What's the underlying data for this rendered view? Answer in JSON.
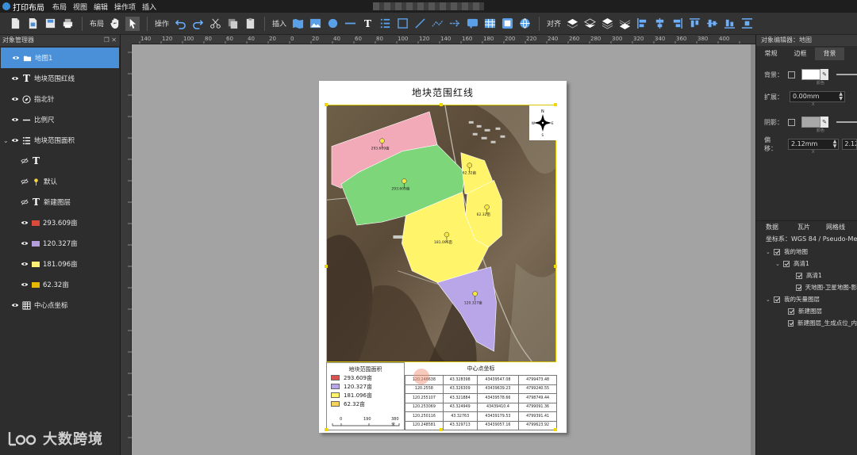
{
  "app": {
    "title": "打印布局",
    "menu": [
      "布局",
      "视图",
      "编辑",
      "操作项",
      "插入"
    ]
  },
  "toolbar": {
    "layout_label": "布局",
    "operate_label": "操作",
    "insert_label": "插入",
    "align_label": "对齐"
  },
  "left_panel": {
    "header": "对象管理器",
    "layers": [
      {
        "label": "地图1",
        "icon": "folder-icon",
        "selected": true
      },
      {
        "label": "地块范围红线",
        "icon": "text-icon"
      },
      {
        "label": "指北针",
        "icon": "compass-icon"
      },
      {
        "label": "比例尺",
        "icon": "scale-icon"
      },
      {
        "label": "地块范围面积",
        "icon": "legend-icon",
        "expanded": true
      },
      {
        "label": "",
        "icon": "text-icon"
      },
      {
        "label": "默认",
        "icon": "pin-icon"
      },
      {
        "label": "新建图层",
        "icon": "text-icon"
      },
      {
        "label": "293.609亩",
        "color": "#d94a3a"
      },
      {
        "label": "120.327亩",
        "color": "#b39ddb"
      },
      {
        "label": "181.096亩",
        "color": "#fff176"
      },
      {
        "label": "62.32亩",
        "color": "#e6b800"
      },
      {
        "label": "中心点坐标",
        "icon": "table-icon"
      }
    ]
  },
  "ruler": {
    "top": [
      "140",
      "120",
      "100",
      "80",
      "60",
      "40",
      "20",
      "0",
      "20",
      "40",
      "60",
      "80",
      "100",
      "120",
      "140",
      "160",
      "180",
      "200",
      "220",
      "240",
      "260",
      "280",
      "300",
      "320",
      "340",
      "360",
      "380",
      "400",
      "420",
      "440"
    ]
  },
  "layout_page": {
    "title": "地块范围红线",
    "map_labels": [
      "293.609亩",
      "120.327亩",
      "181.096亩",
      "62.32亩"
    ],
    "legend": {
      "title": "地块范围面积",
      "items": [
        {
          "label": "293.609亩",
          "color": "#d9534f"
        },
        {
          "label": "120.327亩",
          "color": "#b9a6e8"
        },
        {
          "label": "181.096亩",
          "color": "#fff46a"
        },
        {
          "label": "62.32亩",
          "color": "#f5d25a"
        }
      ],
      "scale_ticks": [
        "0",
        "190",
        "380 米"
      ]
    },
    "coord_table": {
      "title": "中心点坐标",
      "rows": [
        [
          "120.248638",
          "43.328398",
          "43439547.08",
          "4799473.48"
        ],
        [
          "120.2558",
          "43.326309",
          "43439639.23",
          "4799240.55"
        ],
        [
          "120.255107",
          "43.321884",
          "43439578.66",
          "4798749.44"
        ],
        [
          "120.253069",
          "43.324949",
          "43439410.4",
          "4799091.36"
        ],
        [
          "120.250116",
          "43.32763",
          "43439179.53",
          "4799391.41"
        ],
        [
          "120.248581",
          "43.329713",
          "43439057.16",
          "4799623.92"
        ]
      ]
    }
  },
  "right_panel": {
    "header": "对象编辑器：地图",
    "tabs": [
      "常规",
      "边框",
      "背景"
    ],
    "props": {
      "background_label": "背景：",
      "color_caption": "颜色",
      "expand_label": "扩展：",
      "expand_value": "0.00mm",
      "shadow_label": "阴影：",
      "offset_label": "偏移：",
      "offset_value": "2.12mm",
      "offset_value2": "2.12",
      "x_caption": "X"
    },
    "tabs2": [
      "数据",
      "瓦片",
      "网格线"
    ],
    "crs": "坐标系：WGS 84 / Pseudo-Mer",
    "tree": [
      {
        "label": "我的地图",
        "level": 0,
        "arrow": "down"
      },
      {
        "label": "高清1",
        "level": 1,
        "arrow": "down"
      },
      {
        "label": "高清1",
        "level": 2
      },
      {
        "label": "天地图-卫星地图-影",
        "level": 2
      },
      {
        "label": "我的矢量图层",
        "level": 0,
        "arrow": "down"
      },
      {
        "label": "新建图层",
        "level": 1
      },
      {
        "label": "新建图层_生成点位_内",
        "level": 1
      }
    ]
  },
  "watermark": "大数跨境",
  "colors": {
    "accent": "#4a90d9",
    "parcel_pink": "#f2a9b8",
    "parcel_green": "#7ed67a",
    "parcel_yellow": "#fff46a",
    "parcel_purple": "#b9a6e8"
  }
}
